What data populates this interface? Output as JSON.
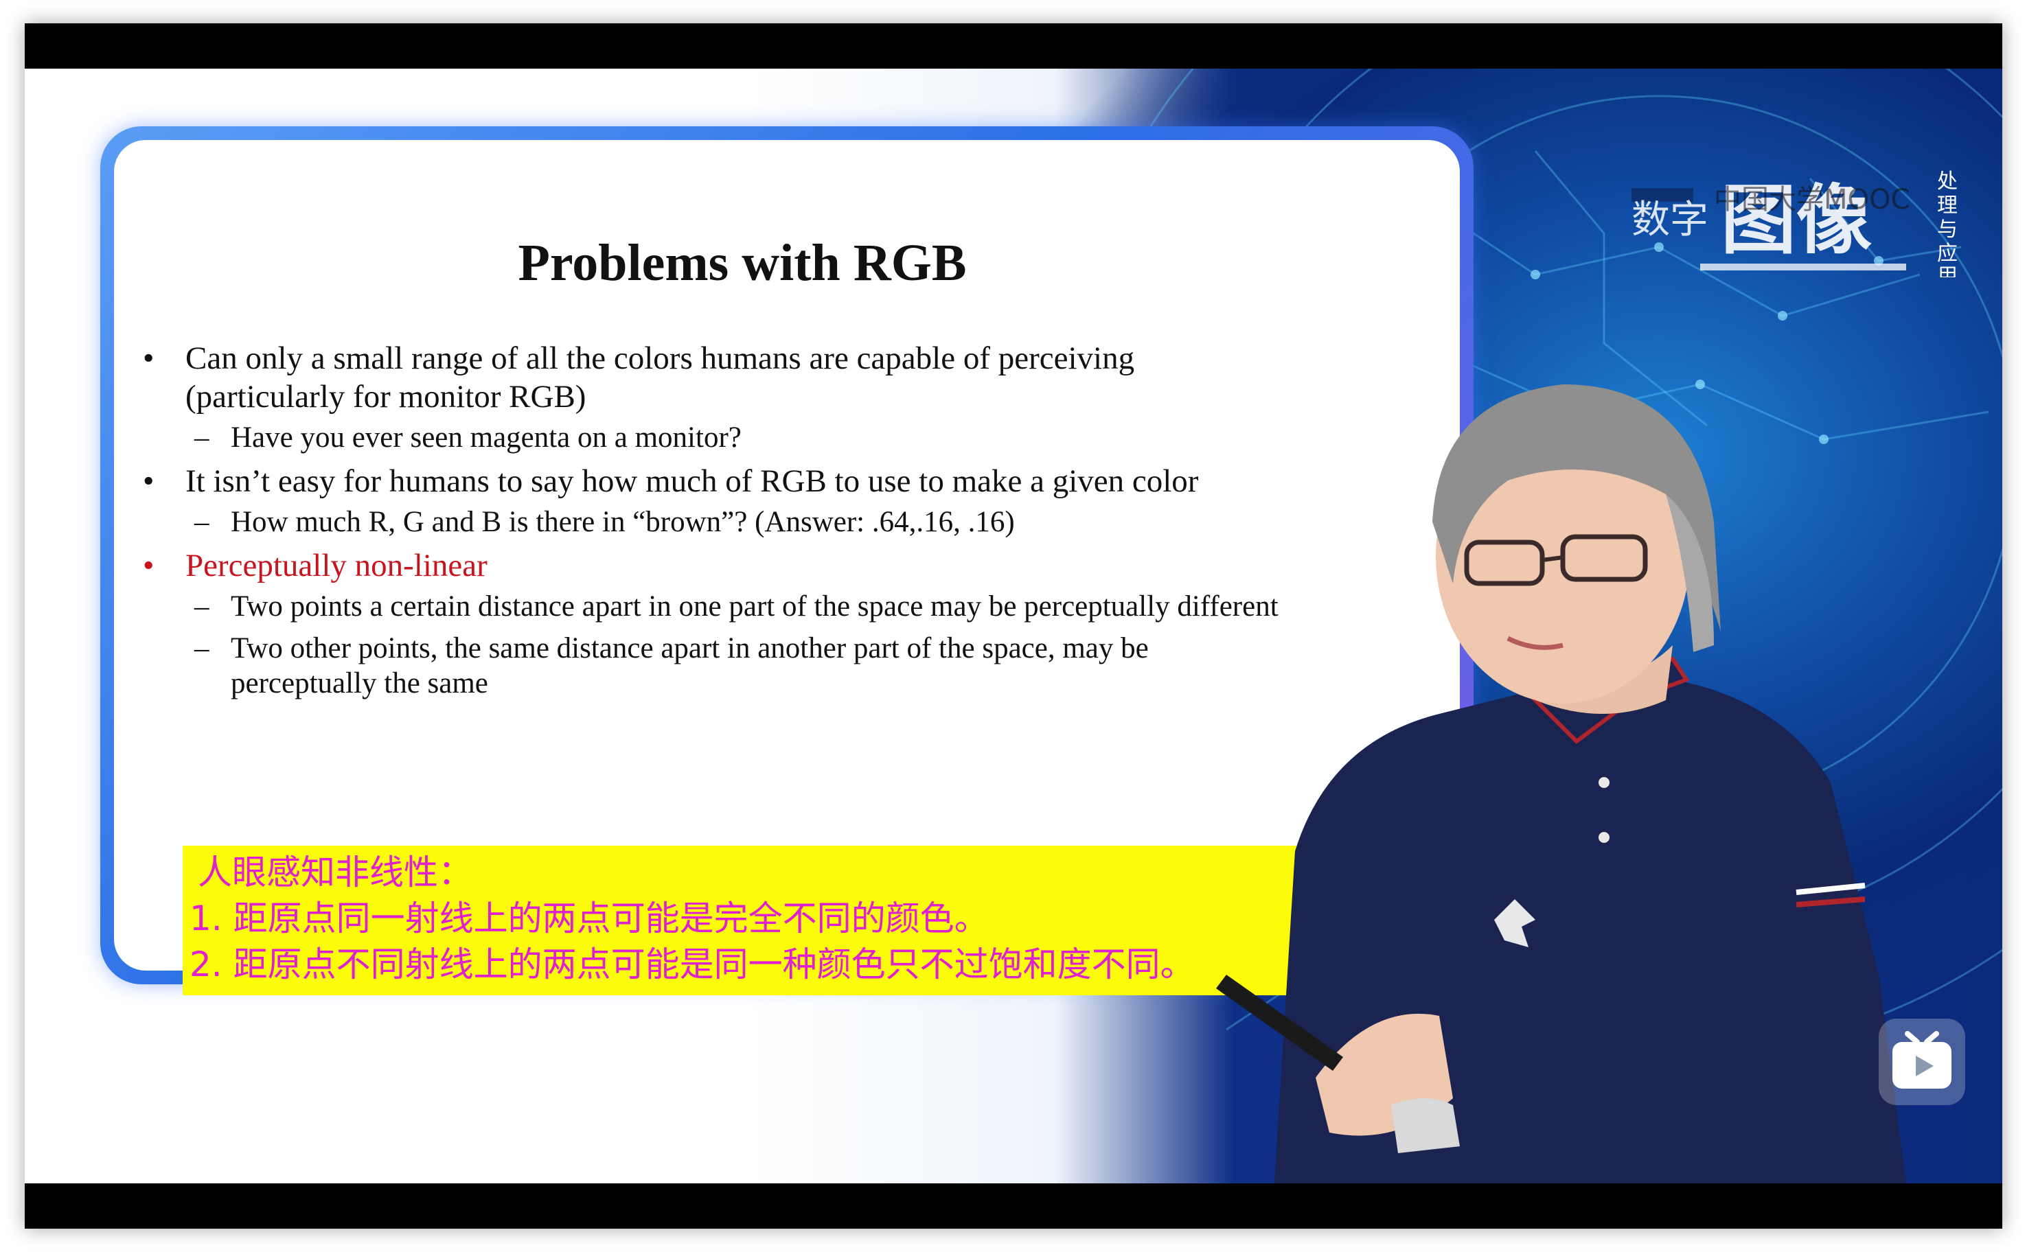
{
  "slide": {
    "title": "Problems with RGB",
    "bullet1": "Can only a small range of all the colors humans are capable of perceiving",
    "bullet1_cont": "(particularly for monitor RGB)",
    "sub1": "Have you ever seen magenta on a monitor?",
    "bullet2": "It isn’t easy for humans to say how much of RGB to use to make a given color",
    "sub2": "How much R, G and B is there in “brown”? (Answer: .64,.16, .16)",
    "bullet3": "Perceptually non-linear",
    "sub3": "Two points a certain distance apart in one part of the space may be perceptually different",
    "sub4": "Two other points, the same distance apart in another part of the space, may be",
    "sub4_cont": "perceptually the same",
    "bullet_symbol": "•",
    "dash_symbol": "–"
  },
  "annotation": {
    "line1": "人眼感知非线性：",
    "line2": "1. 距原点同一射线上的两点可能是完全不同的颜色。",
    "line3": "2. 距原点不同射线上的两点可能是同一种颜色只不过饱和度不同。"
  },
  "watermark": {
    "course_text": "数字",
    "big_text": "图像",
    "vertical_text": "处理与应用",
    "mooc_text": "中国大学MOOC"
  },
  "player": {
    "bili_icon": "bilibili-tv-icon"
  },
  "colors": {
    "highlight_bg": "#fbfb0a",
    "annotation_text": "#e01fd0",
    "bullet_red": "#c8141e"
  }
}
